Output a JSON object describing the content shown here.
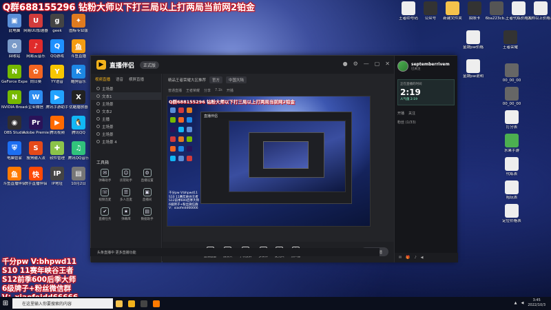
{
  "overlay": {
    "top_banner": "Q群688155296 钻粉大师以下打三局以上打两局当前网2铂金",
    "promo_lines": [
      "千分pw V:bhpwd11",
      "S10 11赛年峡谷王者",
      "S12前季600后季大师",
      "6级牌子+粉丝微信群",
      "V：xiaofeidd66666"
    ]
  },
  "desktop": {
    "left_icons": [
      {
        "label": "此电脑",
        "color": "#5a8fd8",
        "glyph": "▣"
      },
      {
        "label": "网易UU加速器",
        "color": "#d23b3b",
        "glyph": "U"
      },
      {
        "label": "geek",
        "color": "#444",
        "glyph": "g"
      },
      {
        "label": "图标专业版",
        "color": "#e07a1f",
        "glyph": "✦"
      },
      {
        "label": "回收站",
        "color": "#7a9ac8",
        "glyph": "♻"
      },
      {
        "label": "网易云音乐",
        "color": "#e02b2b",
        "glyph": "♪"
      },
      {
        "label": "QQ游戏",
        "color": "#1e90ff",
        "glyph": "Q"
      },
      {
        "label": "斗鱼直播",
        "color": "#f39c12",
        "glyph": "鱼"
      },
      {
        "label": "GeForce Experience",
        "color": "#76b900",
        "glyph": "N"
      },
      {
        "label": "向日葵",
        "color": "#f26522",
        "glyph": "✿"
      },
      {
        "label": "YY语音",
        "color": "#f7c600",
        "glyph": "Y"
      },
      {
        "label": "酷狗音乐",
        "color": "#1e88e5",
        "glyph": "K"
      },
      {
        "label": "NVIDIA Broadcast",
        "color": "#76b900",
        "glyph": "N"
      },
      {
        "label": "企业微信",
        "color": "#2d8cf0",
        "glyph": "W"
      },
      {
        "label": "腾讯手游助手",
        "color": "#22a3ff",
        "glyph": "▶"
      },
      {
        "label": "优酷播放器",
        "color": "#222",
        "glyph": "X"
      },
      {
        "label": "OBS Studio",
        "color": "#302e31",
        "glyph": "◉"
      },
      {
        "label": "Adobe Premiere",
        "color": "#2a1359",
        "glyph": "Pr"
      },
      {
        "label": "腾讯视频",
        "color": "#ff6a00",
        "glyph": "▶"
      },
      {
        "label": "腾讯QQ",
        "color": "#12b7f5",
        "glyph": "🐧"
      },
      {
        "label": "电脑管家",
        "color": "#1d6ff2",
        "glyph": "⛨"
      },
      {
        "label": "搜狗输入法",
        "color": "#e64a19",
        "glyph": "S"
      },
      {
        "label": "软件管理",
        "color": "#8bc34a",
        "glyph": "✚"
      },
      {
        "label": "腾讯QQ音乐",
        "color": "#31c27c",
        "glyph": "♫"
      },
      {
        "label": "斗鱼直播伴侣",
        "color": "#ff7a00",
        "glyph": "鱼"
      },
      {
        "label": "快手直播伴侣",
        "color": "#ff4906",
        "glyph": "快"
      },
      {
        "label": "IP地址",
        "color": "#444",
        "glyph": "IP"
      },
      {
        "label": "10月2日",
        "color": "#777",
        "glyph": "▤"
      }
    ],
    "right_icons_top": [
      {
        "label": "王者ID号码",
        "color": "#eee"
      },
      {
        "label": "公众号",
        "color": "#333"
      },
      {
        "label": "新建文件夹",
        "color": "#f5c24b"
      },
      {
        "label": "拍照卡",
        "color": "#333"
      },
      {
        "label": "6ba223cb...",
        "color": "#555"
      },
      {
        "label": "王者代练价格表",
        "color": "#eee"
      },
      {
        "label": "大师以上价格表",
        "color": "#eee"
      }
    ],
    "right_icons_col": [
      {
        "label": "金牌pw价格",
        "color": "#eee"
      },
      {
        "label": "王者荣耀",
        "color": "#333"
      },
      {
        "label": "金牌pw说明",
        "color": "#eee"
      },
      {
        "label": "00_00_00",
        "color": "#666"
      },
      {
        "label": "00_00_00",
        "color": "#666"
      },
      {
        "label": "打分表",
        "color": "#eee"
      },
      {
        "label": "水果手游",
        "color": "#4caf50"
      },
      {
        "label": "代练表",
        "color": "#eee"
      },
      {
        "label": "陪玩表",
        "color": "#eee"
      },
      {
        "label": "定位价格表",
        "color": "#eee"
      }
    ]
  },
  "app": {
    "name": "直播伴侣",
    "version": "正式版",
    "scene_tabs": [
      "视频直播",
      "语音",
      "横屏直播"
    ],
    "sources": [
      "主场景",
      "文本1",
      "主场景",
      "文本2",
      "主播",
      "主场景",
      "主场景",
      "主场景 4"
    ],
    "tools_title": "工具箱",
    "tools": [
      {
        "label": "弹幕助手",
        "glyph": "✉"
      },
      {
        "label": "房管助手",
        "glyph": "☺"
      },
      {
        "label": "直播设置",
        "glyph": "⚙"
      },
      {
        "label": "视频连麦",
        "glyph": "☏"
      },
      {
        "label": "多人连麦",
        "glyph": "☰"
      },
      {
        "label": "直播间",
        "glyph": "▣"
      },
      {
        "label": "直播任务",
        "glyph": "✔"
      },
      {
        "label": "弹幕库",
        "glyph": "★"
      },
      {
        "label": "数据助手",
        "glyph": "▤"
      }
    ],
    "preview": {
      "header_title": "精品王者荣耀大区推荐",
      "header_pills": [
        "官方",
        "中国大陆"
      ],
      "sub_items": [
        "普通直播",
        "王者荣耀",
        "分享",
        "7.1k",
        "开播"
      ],
      "banner": "Q群688155296 钻粉大师以下打三局以上打两局当前网2铂金",
      "note_lines": [
        "千分pw V:bhpwd11",
        "S10 11赛年峡谷王者",
        "S12前季600后季大师",
        "6级牌子+粉丝微信群",
        "V：xiaofeidd66666"
      ]
    },
    "bottom_tools": [
      {
        "label": "直播画面",
        "glyph": "▢"
      },
      {
        "label": "摄像头",
        "glyph": "◉"
      },
      {
        "label": "手机投屏",
        "glyph": "▯"
      },
      {
        "label": "多媒体",
        "glyph": "▶"
      },
      {
        "label": "麦克风",
        "glyph": "♪"
      },
      {
        "label": "扬声器",
        "glyph": "♫"
      }
    ],
    "live_button": "开始直播",
    "status": "头条直播中 更多直播功能"
  },
  "chat": {
    "username": "septemberrivem",
    "user_sub": "已关注",
    "timer_header": "正在直播的时间",
    "timer": "2:19",
    "timer_sub": "人气值 2:19",
    "tabs": [
      "开播",
      "关注"
    ],
    "fans": "粉丝 (1/33)"
  },
  "taskbar": {
    "search_placeholder": "在这里输入你要搜索的内容",
    "time": "3:45",
    "date": "2022/10/3"
  }
}
